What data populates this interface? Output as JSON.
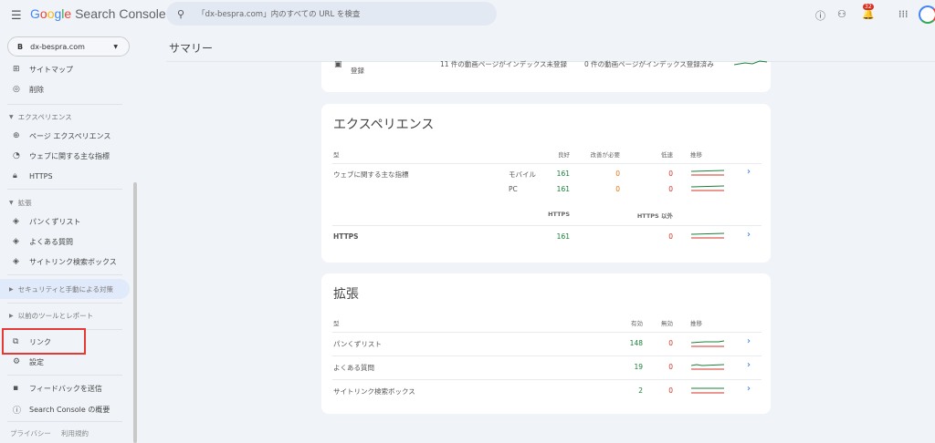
{
  "header": {
    "app_name": "Google Search Console",
    "search_placeholder": "「dx-bespra.com」内のすべての URL を検査",
    "notifications": "32"
  },
  "sidebar": {
    "property": "dx-bespra.com",
    "items_top": [
      {
        "label": "サイトマップ"
      },
      {
        "label": "削除"
      }
    ],
    "experience": {
      "header": "エクスペリエンス",
      "items": [
        {
          "label": "ページ エクスペリエンス"
        },
        {
          "label": "ウェブに関する主な指標"
        },
        {
          "label": "HTTPS"
        }
      ]
    },
    "extensions": {
      "header": "拡張",
      "items": [
        {
          "label": "パンくずリスト"
        },
        {
          "label": "よくある質問"
        },
        {
          "label": "サイトリンク検索ボックス"
        }
      ]
    },
    "security": "セキュリティと手動による対策",
    "legacy": "以前のツールとレポート",
    "links": "リンク",
    "settings": "設定",
    "feedback": "フィードバックを送信",
    "about": "Search Console の概要",
    "privacy": "プライバシー",
    "terms": "利用規約"
  },
  "main": {
    "title": "サマリー",
    "video_card": {
      "label": "登録",
      "not_indexed": "11 件の動画ページがインデックス未登録",
      "indexed": "0 件の動画ページがインデックス登録済み"
    },
    "experience": {
      "title": "エクスペリエンス",
      "col_type": "型",
      "col_good": "良好",
      "col_needs": "改善が必要",
      "col_poor": "低速",
      "col_trend": "推移",
      "cwv": {
        "label": "ウェブに関する主な指標",
        "rows": [
          {
            "device": "モバイル",
            "good": "161",
            "needs": "0",
            "poor": "0"
          },
          {
            "device": "PC",
            "good": "161",
            "needs": "0",
            "poor": "0"
          }
        ]
      },
      "col_https": "HTTPS",
      "col_non_https": "HTTPS 以外",
      "https": {
        "label": "HTTPS",
        "https": "161",
        "non_https": "0"
      }
    },
    "extensions": {
      "title": "拡張",
      "col_type": "型",
      "col_valid": "有効",
      "col_invalid": "無効",
      "col_trend": "推移",
      "rows": [
        {
          "label": "パンくずリスト",
          "valid": "148",
          "invalid": "0"
        },
        {
          "label": "よくある質問",
          "valid": "19",
          "invalid": "0"
        },
        {
          "label": "サイトリンク検索ボックス",
          "valid": "2",
          "invalid": "0"
        }
      ]
    }
  }
}
